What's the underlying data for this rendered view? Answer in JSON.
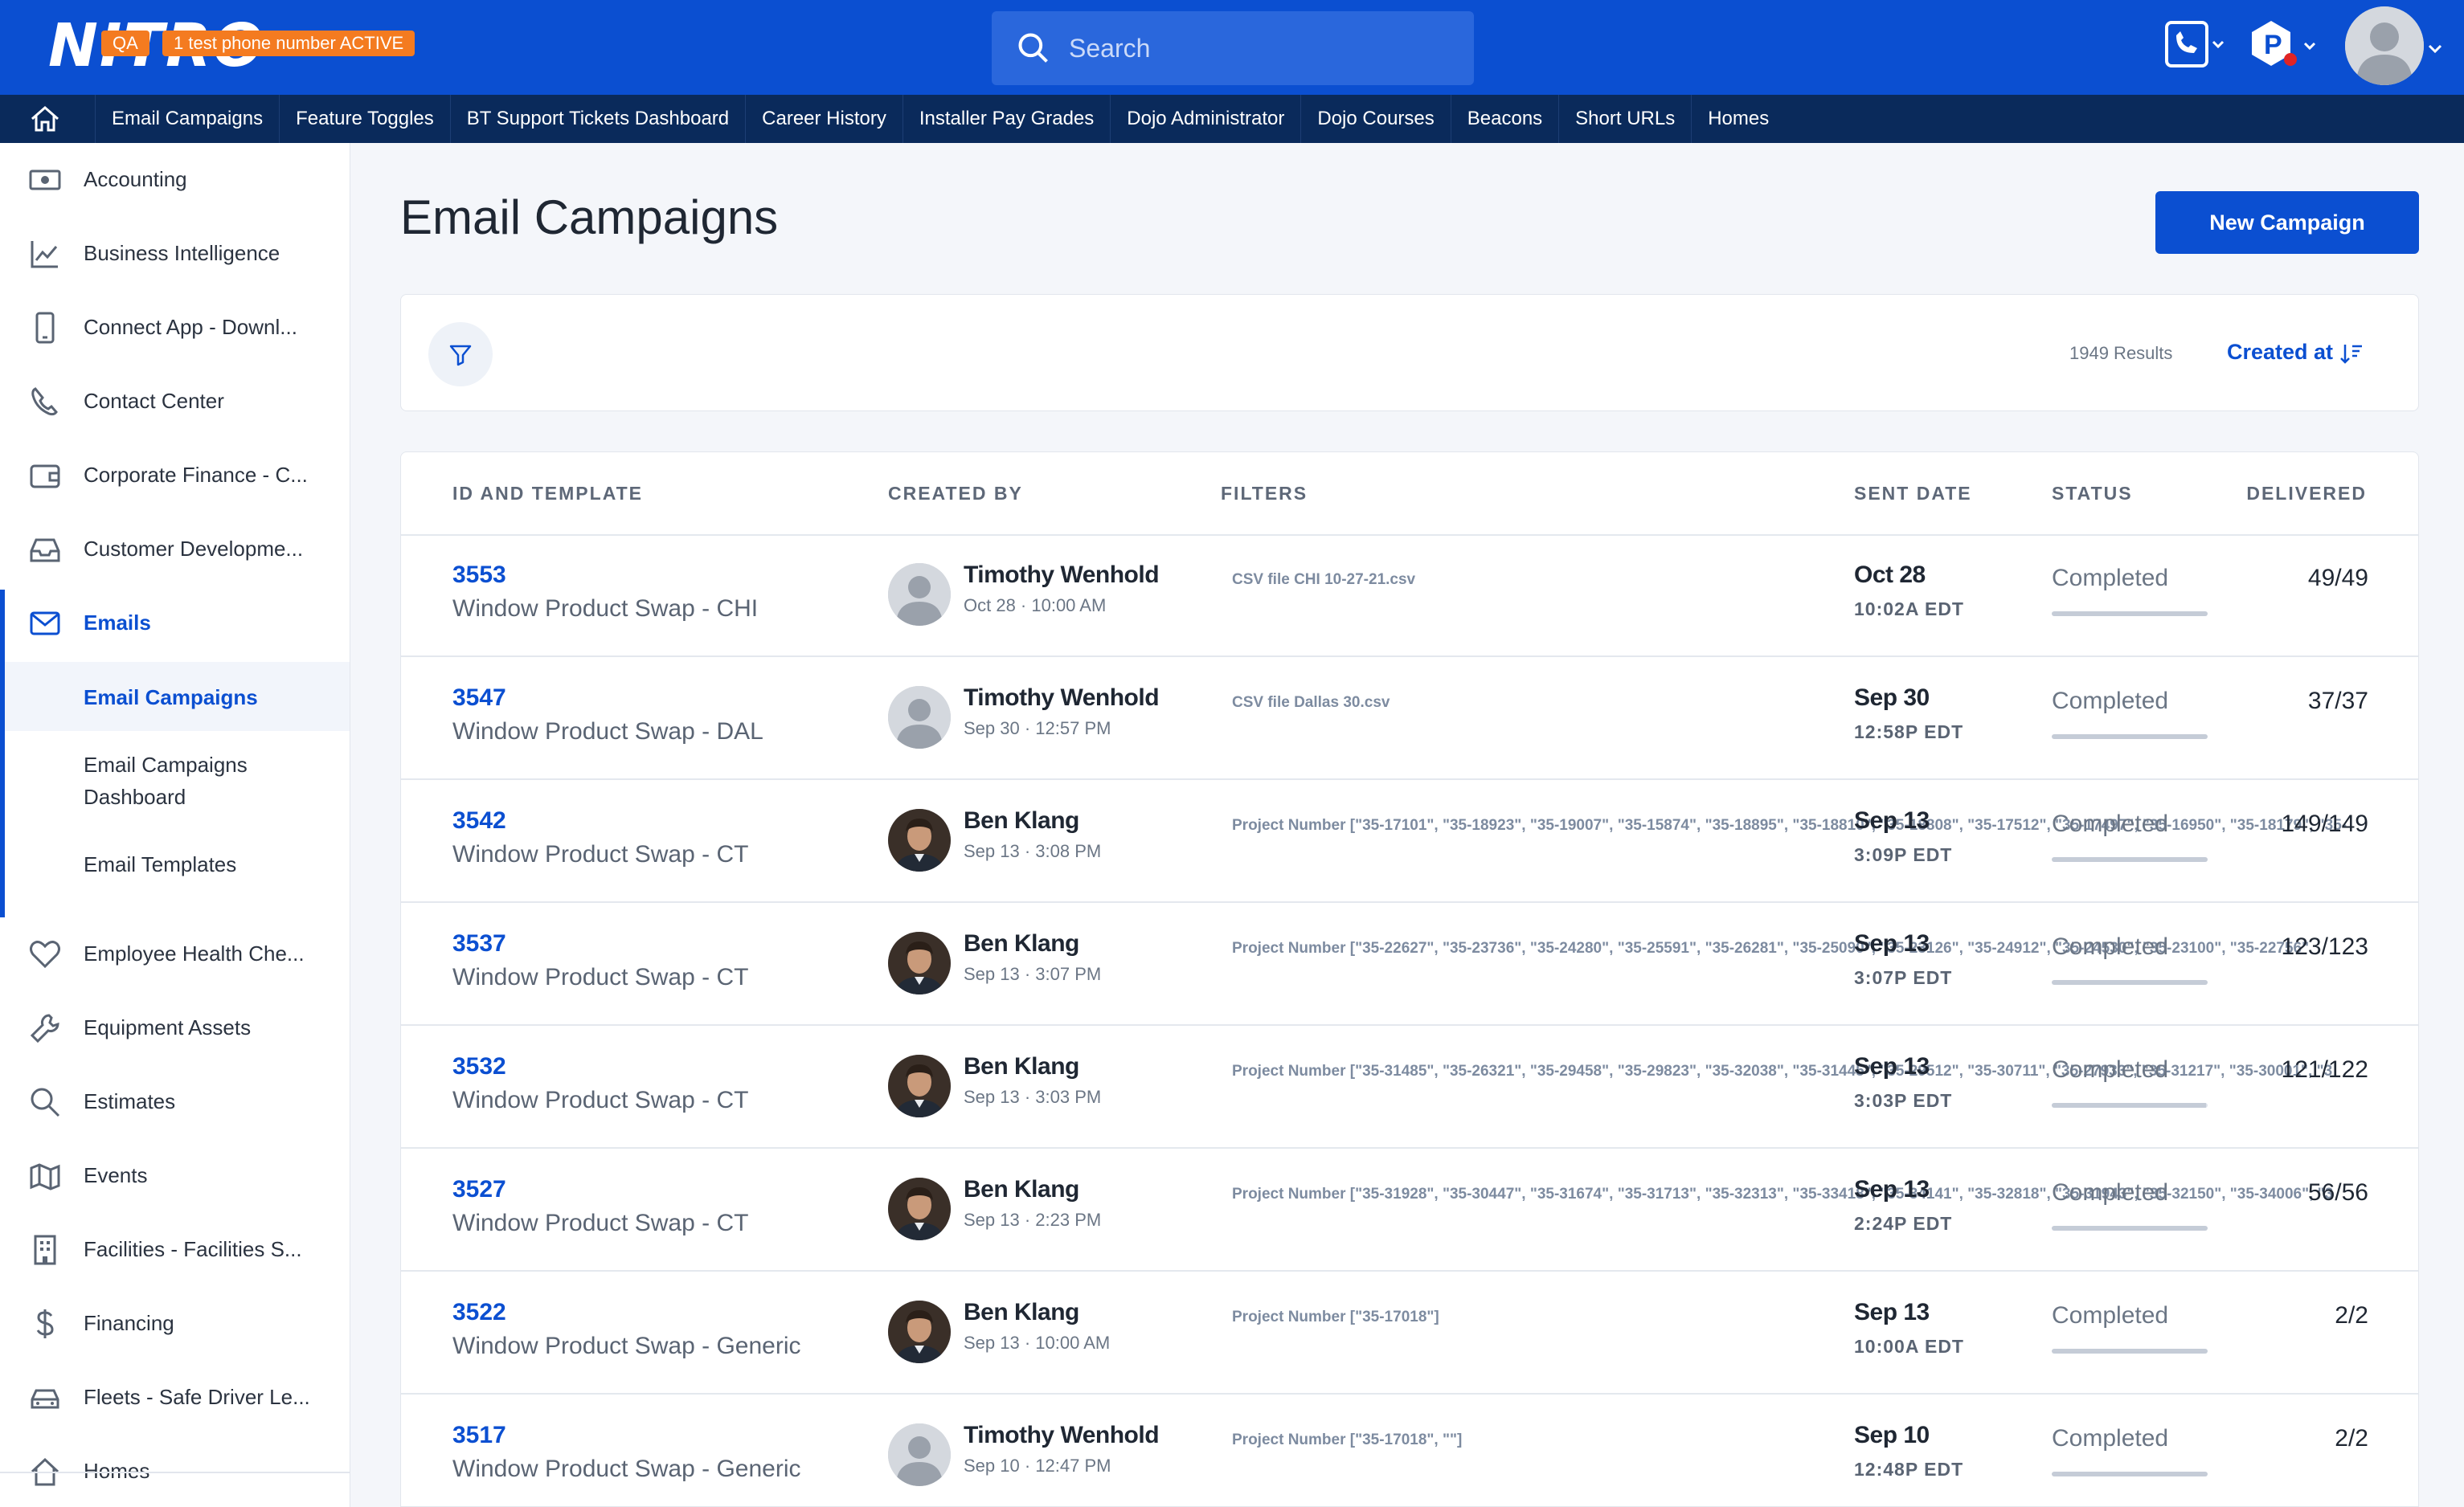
{
  "app": {
    "logo_text": "NITRO",
    "env_badge": "QA",
    "phone_badge": "1 test phone number ACTIVE"
  },
  "search": {
    "placeholder": "Search"
  },
  "nav": {
    "items": [
      "Email Campaigns",
      "Feature Toggles",
      "BT Support Tickets Dashboard",
      "Career History",
      "Installer Pay Grades",
      "Dojo Administrator",
      "Dojo Courses",
      "Beacons",
      "Short URLs",
      "Homes"
    ]
  },
  "sidebar": {
    "items": [
      {
        "label": "Accounting",
        "icon": "money-icon"
      },
      {
        "label": "Business Intelligence",
        "icon": "chart-icon"
      },
      {
        "label": "Connect App - Downl...",
        "icon": "phone-device-icon"
      },
      {
        "label": "Contact Center",
        "icon": "phone-icon"
      },
      {
        "label": "Corporate Finance - C...",
        "icon": "wallet-icon"
      },
      {
        "label": "Customer Developme...",
        "icon": "inbox-icon"
      },
      {
        "label": "Emails",
        "icon": "mail-icon"
      }
    ],
    "sub_items": [
      "Email Campaigns",
      "Email Campaigns Dashboard",
      "Email Templates"
    ],
    "items_after": [
      {
        "label": "Employee Health Che...",
        "icon": "heart-icon"
      },
      {
        "label": "Equipment Assets",
        "icon": "wrench-icon"
      },
      {
        "label": "Estimates",
        "icon": "search-icon"
      },
      {
        "label": "Events",
        "icon": "map-icon"
      },
      {
        "label": "Facilities - Facilities S...",
        "icon": "building-icon"
      },
      {
        "label": "Financing",
        "icon": "dollar-icon"
      },
      {
        "label": "Fleets - Safe Driver Le...",
        "icon": "car-icon"
      },
      {
        "label": "Homes",
        "icon": "home-icon"
      }
    ]
  },
  "page": {
    "title": "Email Campaigns",
    "new_button": "New Campaign",
    "results": "1949 Results",
    "sort_label": "Created at"
  },
  "table": {
    "headers": [
      "ID AND TEMPLATE",
      "CREATED BY",
      "FILTERS",
      "SENT DATE",
      "STATUS",
      "DELIVERED"
    ],
    "rows": [
      {
        "id": "3553",
        "template": "Window Product Swap - CHI",
        "creator": "Timothy Wenhold",
        "created": "Oct 28 · 10:00 AM",
        "avatar": "placeholder",
        "filter": "CSV file CHI 10-27-21.csv",
        "date": "Oct 28",
        "time": "10:02A EDT",
        "status": "Completed",
        "progress": 1.0,
        "delivered": "49/49"
      },
      {
        "id": "3547",
        "template": "Window Product Swap - DAL",
        "creator": "Timothy Wenhold",
        "created": "Sep 30 · 12:57 PM",
        "avatar": "placeholder",
        "filter": "CSV file Dallas 30.csv",
        "date": "Sep 30",
        "time": "12:58P EDT",
        "status": "Completed",
        "progress": 1.0,
        "delivered": "37/37"
      },
      {
        "id": "3542",
        "template": "Window Product Swap - CT",
        "creator": "Ben Klang",
        "created": "Sep 13 · 3:08 PM",
        "avatar": "photo",
        "filter": "Project Number [\"35-17101\", \"35-18923\", \"35-19007\", \"35-15874\", \"35-18895\", \"35-18810\", \"35-18808\", \"35-17512\", \"35-17497\", \"35-16950\", \"35-18179\", \"35-",
        "date": "Sep 13",
        "time": "3:09P EDT",
        "status": "Completed",
        "progress": 1.0,
        "delivered": "149/149"
      },
      {
        "id": "3537",
        "template": "Window Product Swap - CT",
        "creator": "Ben Klang",
        "created": "Sep 13 · 3:07 PM",
        "avatar": "photo",
        "filter": "Project Number [\"35-22627\", \"35-23736\", \"35-24280\", \"35-25591\", \"35-26281\", \"35-25090\", \"35-23126\", \"35-24912\", \"35-24530\", \"35-23100\", \"35-22756\"",
        "date": "Sep 13",
        "time": "3:07P EDT",
        "status": "Completed",
        "progress": 1.0,
        "delivered": "123/123"
      },
      {
        "id": "3532",
        "template": "Window Product Swap - CT",
        "creator": "Ben Klang",
        "created": "Sep 13 · 3:03 PM",
        "avatar": "photo",
        "filter": "Project Number [\"35-31485\", \"35-26321\", \"35-29458\", \"35-29823\", \"35-32038\", \"35-31445\", \"35-29512\", \"35-30711\", \"35-27933\", \"35-31217\", \"35-30001\", \"3",
        "date": "Sep 13",
        "time": "3:03P EDT",
        "status": "Completed",
        "progress": 0.99,
        "delivered": "121/122"
      },
      {
        "id": "3527",
        "template": "Window Product Swap - CT",
        "creator": "Ben Klang",
        "created": "Sep 13 · 2:23 PM",
        "avatar": "photo",
        "filter": "Project Number [\"35-31928\", \"35-30447\", \"35-31674\", \"35-31713\", \"35-32313\", \"35-33418\", \"35-34141\", \"35-32818\", \"35-31943\", \"35-32150\", \"35-34006\", \"3",
        "date": "Sep 13",
        "time": "2:24P EDT",
        "status": "Completed",
        "progress": 1.0,
        "delivered": "56/56"
      },
      {
        "id": "3522",
        "template": "Window Product Swap - Generic",
        "creator": "Ben Klang",
        "created": "Sep 13 · 10:00 AM",
        "avatar": "photo",
        "filter": "Project Number [\"35-17018\"]",
        "date": "Sep 13",
        "time": "10:00A EDT",
        "status": "Completed",
        "progress": 1.0,
        "delivered": "2/2"
      },
      {
        "id": "3517",
        "template": "Window Product Swap - Generic",
        "creator": "Timothy Wenhold",
        "created": "Sep 10 · 12:47 PM",
        "avatar": "placeholder",
        "filter": "Project Number [\"35-17018\", \"\"]",
        "date": "Sep 10",
        "time": "12:48P EDT",
        "status": "Completed",
        "progress": 1.0,
        "delivered": "2/2"
      }
    ]
  },
  "colors": {
    "brand": "#0b4fd1",
    "nav": "#0a2a5b",
    "badge": "#f47b20"
  }
}
